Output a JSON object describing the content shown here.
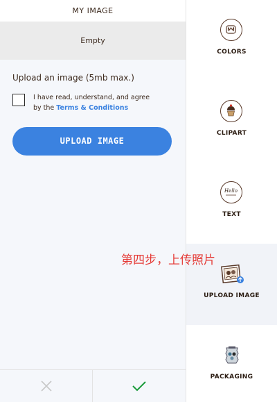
{
  "panel": {
    "title": "MY IMAGE",
    "empty_label": "Empty",
    "upload_hint": "Upload an image (5mb max.)",
    "agree_text_line1": "I have read, understand, and agree",
    "agree_text_prefix": "by the ",
    "terms_link": "Terms & Conditions",
    "upload_button": "UPLOAD IMAGE",
    "agree_checked": false
  },
  "menu": {
    "items": [
      {
        "label": "COLORS",
        "icon": "m-candy-icon"
      },
      {
        "label": "CLIPART",
        "icon": "cupcake-icon"
      },
      {
        "label": "TEXT",
        "icon": "hello-text-icon",
        "icon_text": "Hello"
      },
      {
        "label": "UPLOAD IMAGE",
        "icon": "photo-upload-icon",
        "active": true
      },
      {
        "label": "PACKAGING",
        "icon": "packaging-icon"
      }
    ]
  },
  "annotation": "第四步，上传照片",
  "colors": {
    "accent": "#3b82e0",
    "confirm": "#1a9a3a",
    "cancel": "#c8c8c8",
    "annotation": "#e53935"
  }
}
